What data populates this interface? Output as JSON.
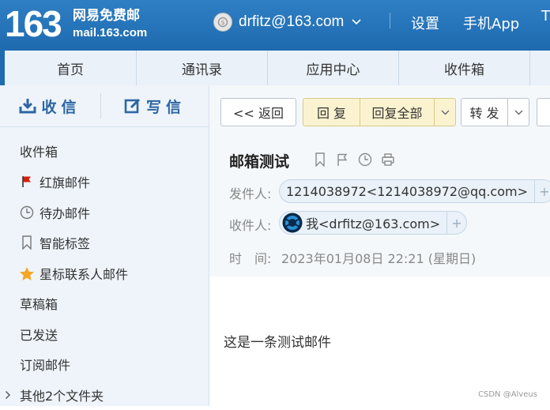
{
  "header": {
    "logo_number": "163",
    "logo_cn": "网易免费邮",
    "logo_url": "mail.163.com",
    "user_email": "drfitz@163.com",
    "settings": "设置",
    "mobile_app": "手机App",
    "more": "T"
  },
  "nav": {
    "tabs": [
      {
        "label": "首页"
      },
      {
        "label": "通讯录"
      },
      {
        "label": "应用中心"
      },
      {
        "label": "收件箱"
      }
    ]
  },
  "sidebar": {
    "receive": "收信",
    "write": "写信",
    "folders": [
      {
        "label": "收件箱",
        "icon": ""
      },
      {
        "label": "红旗邮件",
        "icon": "red-flag-icon"
      },
      {
        "label": "待办邮件",
        "icon": "clock-icon"
      },
      {
        "label": "智能标签",
        "icon": "bookmark-icon"
      },
      {
        "label": "星标联系人邮件",
        "icon": "star-icon"
      },
      {
        "label": "草稿箱",
        "icon": ""
      },
      {
        "label": "已发送",
        "icon": ""
      },
      {
        "label": "订阅邮件",
        "icon": ""
      },
      {
        "label": "其他2个文件夹",
        "icon": "chevron-right-icon"
      }
    ]
  },
  "toolbar": {
    "back": "<< 返回",
    "reply": "回 复",
    "reply_all": "回复全部",
    "forward": "转 发"
  },
  "mail": {
    "subject": "邮箱测试",
    "from_label": "发件人:",
    "from_value": "1214038972<1214038972@qq.com>",
    "to_label": "收件人:",
    "to_value": "我<drfitz@163.com>",
    "time_label": "时　间:",
    "time_value": "2023年01月08日 22:21 (星期日)",
    "body": "这是一条测试邮件"
  },
  "watermark": "CSDN @Alveus",
  "colors": {
    "brand_blue": "#1f6bb0",
    "sidebar_bg": "#eef4fa",
    "reply_yellow": "#fbf3d0",
    "flag_red": "#d81e06",
    "star_orange": "#f5a623"
  }
}
